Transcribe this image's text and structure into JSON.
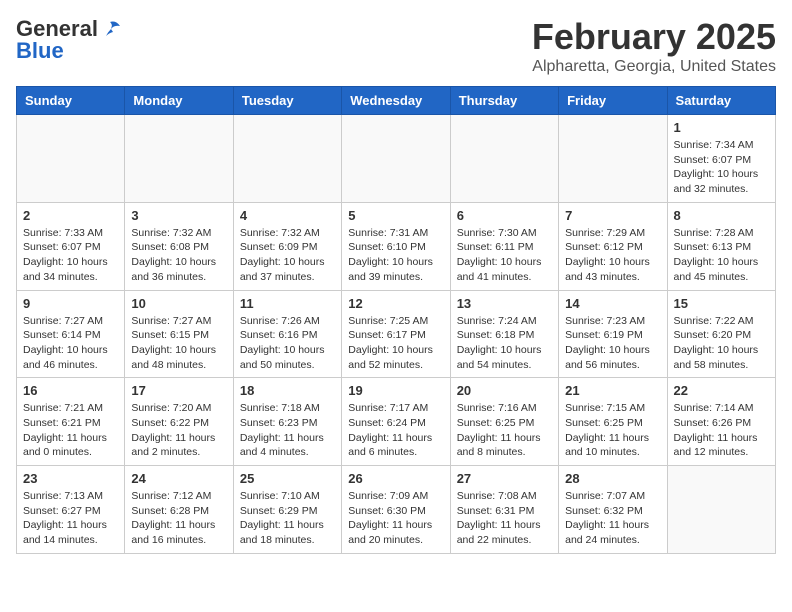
{
  "header": {
    "logo_line1": "General",
    "logo_line2": "Blue",
    "month": "February 2025",
    "location": "Alpharetta, Georgia, United States"
  },
  "weekdays": [
    "Sunday",
    "Monday",
    "Tuesday",
    "Wednesday",
    "Thursday",
    "Friday",
    "Saturday"
  ],
  "weeks": [
    [
      {
        "day": "",
        "info": ""
      },
      {
        "day": "",
        "info": ""
      },
      {
        "day": "",
        "info": ""
      },
      {
        "day": "",
        "info": ""
      },
      {
        "day": "",
        "info": ""
      },
      {
        "day": "",
        "info": ""
      },
      {
        "day": "1",
        "info": "Sunrise: 7:34 AM\nSunset: 6:07 PM\nDaylight: 10 hours and 32 minutes."
      }
    ],
    [
      {
        "day": "2",
        "info": "Sunrise: 7:33 AM\nSunset: 6:07 PM\nDaylight: 10 hours and 34 minutes."
      },
      {
        "day": "3",
        "info": "Sunrise: 7:32 AM\nSunset: 6:08 PM\nDaylight: 10 hours and 36 minutes."
      },
      {
        "day": "4",
        "info": "Sunrise: 7:32 AM\nSunset: 6:09 PM\nDaylight: 10 hours and 37 minutes."
      },
      {
        "day": "5",
        "info": "Sunrise: 7:31 AM\nSunset: 6:10 PM\nDaylight: 10 hours and 39 minutes."
      },
      {
        "day": "6",
        "info": "Sunrise: 7:30 AM\nSunset: 6:11 PM\nDaylight: 10 hours and 41 minutes."
      },
      {
        "day": "7",
        "info": "Sunrise: 7:29 AM\nSunset: 6:12 PM\nDaylight: 10 hours and 43 minutes."
      },
      {
        "day": "8",
        "info": "Sunrise: 7:28 AM\nSunset: 6:13 PM\nDaylight: 10 hours and 45 minutes."
      }
    ],
    [
      {
        "day": "9",
        "info": "Sunrise: 7:27 AM\nSunset: 6:14 PM\nDaylight: 10 hours and 46 minutes."
      },
      {
        "day": "10",
        "info": "Sunrise: 7:27 AM\nSunset: 6:15 PM\nDaylight: 10 hours and 48 minutes."
      },
      {
        "day": "11",
        "info": "Sunrise: 7:26 AM\nSunset: 6:16 PM\nDaylight: 10 hours and 50 minutes."
      },
      {
        "day": "12",
        "info": "Sunrise: 7:25 AM\nSunset: 6:17 PM\nDaylight: 10 hours and 52 minutes."
      },
      {
        "day": "13",
        "info": "Sunrise: 7:24 AM\nSunset: 6:18 PM\nDaylight: 10 hours and 54 minutes."
      },
      {
        "day": "14",
        "info": "Sunrise: 7:23 AM\nSunset: 6:19 PM\nDaylight: 10 hours and 56 minutes."
      },
      {
        "day": "15",
        "info": "Sunrise: 7:22 AM\nSunset: 6:20 PM\nDaylight: 10 hours and 58 minutes."
      }
    ],
    [
      {
        "day": "16",
        "info": "Sunrise: 7:21 AM\nSunset: 6:21 PM\nDaylight: 11 hours and 0 minutes."
      },
      {
        "day": "17",
        "info": "Sunrise: 7:20 AM\nSunset: 6:22 PM\nDaylight: 11 hours and 2 minutes."
      },
      {
        "day": "18",
        "info": "Sunrise: 7:18 AM\nSunset: 6:23 PM\nDaylight: 11 hours and 4 minutes."
      },
      {
        "day": "19",
        "info": "Sunrise: 7:17 AM\nSunset: 6:24 PM\nDaylight: 11 hours and 6 minutes."
      },
      {
        "day": "20",
        "info": "Sunrise: 7:16 AM\nSunset: 6:25 PM\nDaylight: 11 hours and 8 minutes."
      },
      {
        "day": "21",
        "info": "Sunrise: 7:15 AM\nSunset: 6:25 PM\nDaylight: 11 hours and 10 minutes."
      },
      {
        "day": "22",
        "info": "Sunrise: 7:14 AM\nSunset: 6:26 PM\nDaylight: 11 hours and 12 minutes."
      }
    ],
    [
      {
        "day": "23",
        "info": "Sunrise: 7:13 AM\nSunset: 6:27 PM\nDaylight: 11 hours and 14 minutes."
      },
      {
        "day": "24",
        "info": "Sunrise: 7:12 AM\nSunset: 6:28 PM\nDaylight: 11 hours and 16 minutes."
      },
      {
        "day": "25",
        "info": "Sunrise: 7:10 AM\nSunset: 6:29 PM\nDaylight: 11 hours and 18 minutes."
      },
      {
        "day": "26",
        "info": "Sunrise: 7:09 AM\nSunset: 6:30 PM\nDaylight: 11 hours and 20 minutes."
      },
      {
        "day": "27",
        "info": "Sunrise: 7:08 AM\nSunset: 6:31 PM\nDaylight: 11 hours and 22 minutes."
      },
      {
        "day": "28",
        "info": "Sunrise: 7:07 AM\nSunset: 6:32 PM\nDaylight: 11 hours and 24 minutes."
      },
      {
        "day": "",
        "info": ""
      }
    ]
  ]
}
